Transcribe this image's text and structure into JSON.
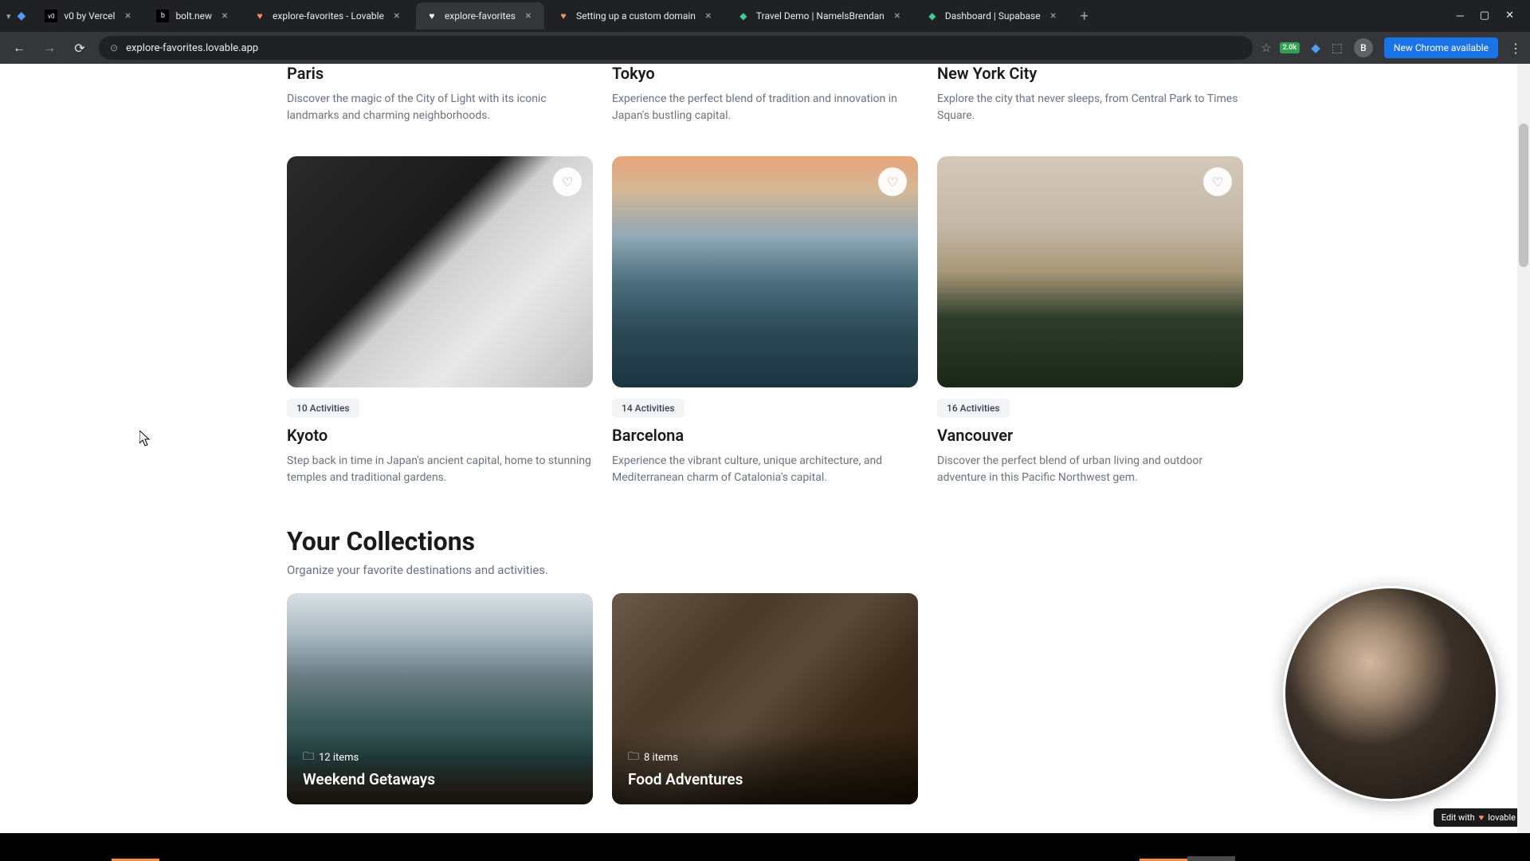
{
  "browser": {
    "tabs": [
      {
        "favicon": "v0",
        "title": "v0 by Vercel"
      },
      {
        "favicon": "b",
        "title": "bolt.new"
      },
      {
        "favicon": "♥",
        "title": "explore-favorites - Lovable"
      },
      {
        "favicon": "♥",
        "title": "explore-favorites",
        "active": true
      },
      {
        "favicon": "♥",
        "title": "Setting up a custom domain"
      },
      {
        "favicon": "◆",
        "title": "Travel Demo | NamelsBrendan"
      },
      {
        "favicon": "◆",
        "title": "Dashboard | Supabase"
      }
    ],
    "url": "explore-favorites.lovable.app",
    "ext_badge": "2.0k",
    "avatar_letter": "B",
    "update_label": "New Chrome available"
  },
  "top_cards": [
    {
      "title": "Paris",
      "desc": "Discover the magic of the City of Light with its iconic landmarks and charming neighborhoods."
    },
    {
      "title": "Tokyo",
      "desc": "Experience the perfect blend of tradition and innovation in Japan's bustling capital."
    },
    {
      "title": "New York City",
      "desc": "Explore the city that never sleeps, from Central Park to Times Square."
    }
  ],
  "dest_cards": [
    {
      "badge": "10 Activities",
      "title": "Kyoto",
      "desc": "Step back in time in Japan's ancient capital, home to stunning temples and traditional gardens."
    },
    {
      "badge": "14 Activities",
      "title": "Barcelona",
      "desc": "Experience the vibrant culture, unique architecture, and Mediterranean charm of Catalonia's capital."
    },
    {
      "badge": "16 Activities",
      "title": "Vancouver",
      "desc": "Discover the perfect blend of urban living and outdoor adventure in this Pacific Northwest gem."
    }
  ],
  "collections": {
    "title": "Your Collections",
    "subtitle": "Organize your favorite destinations and activities.",
    "items": [
      {
        "count": "12 items",
        "title": "Weekend Getaways"
      },
      {
        "count": "8 items",
        "title": "Food Adventures"
      }
    ]
  },
  "edit_badge": {
    "prefix": "Edit with",
    "brand": "lovable"
  }
}
